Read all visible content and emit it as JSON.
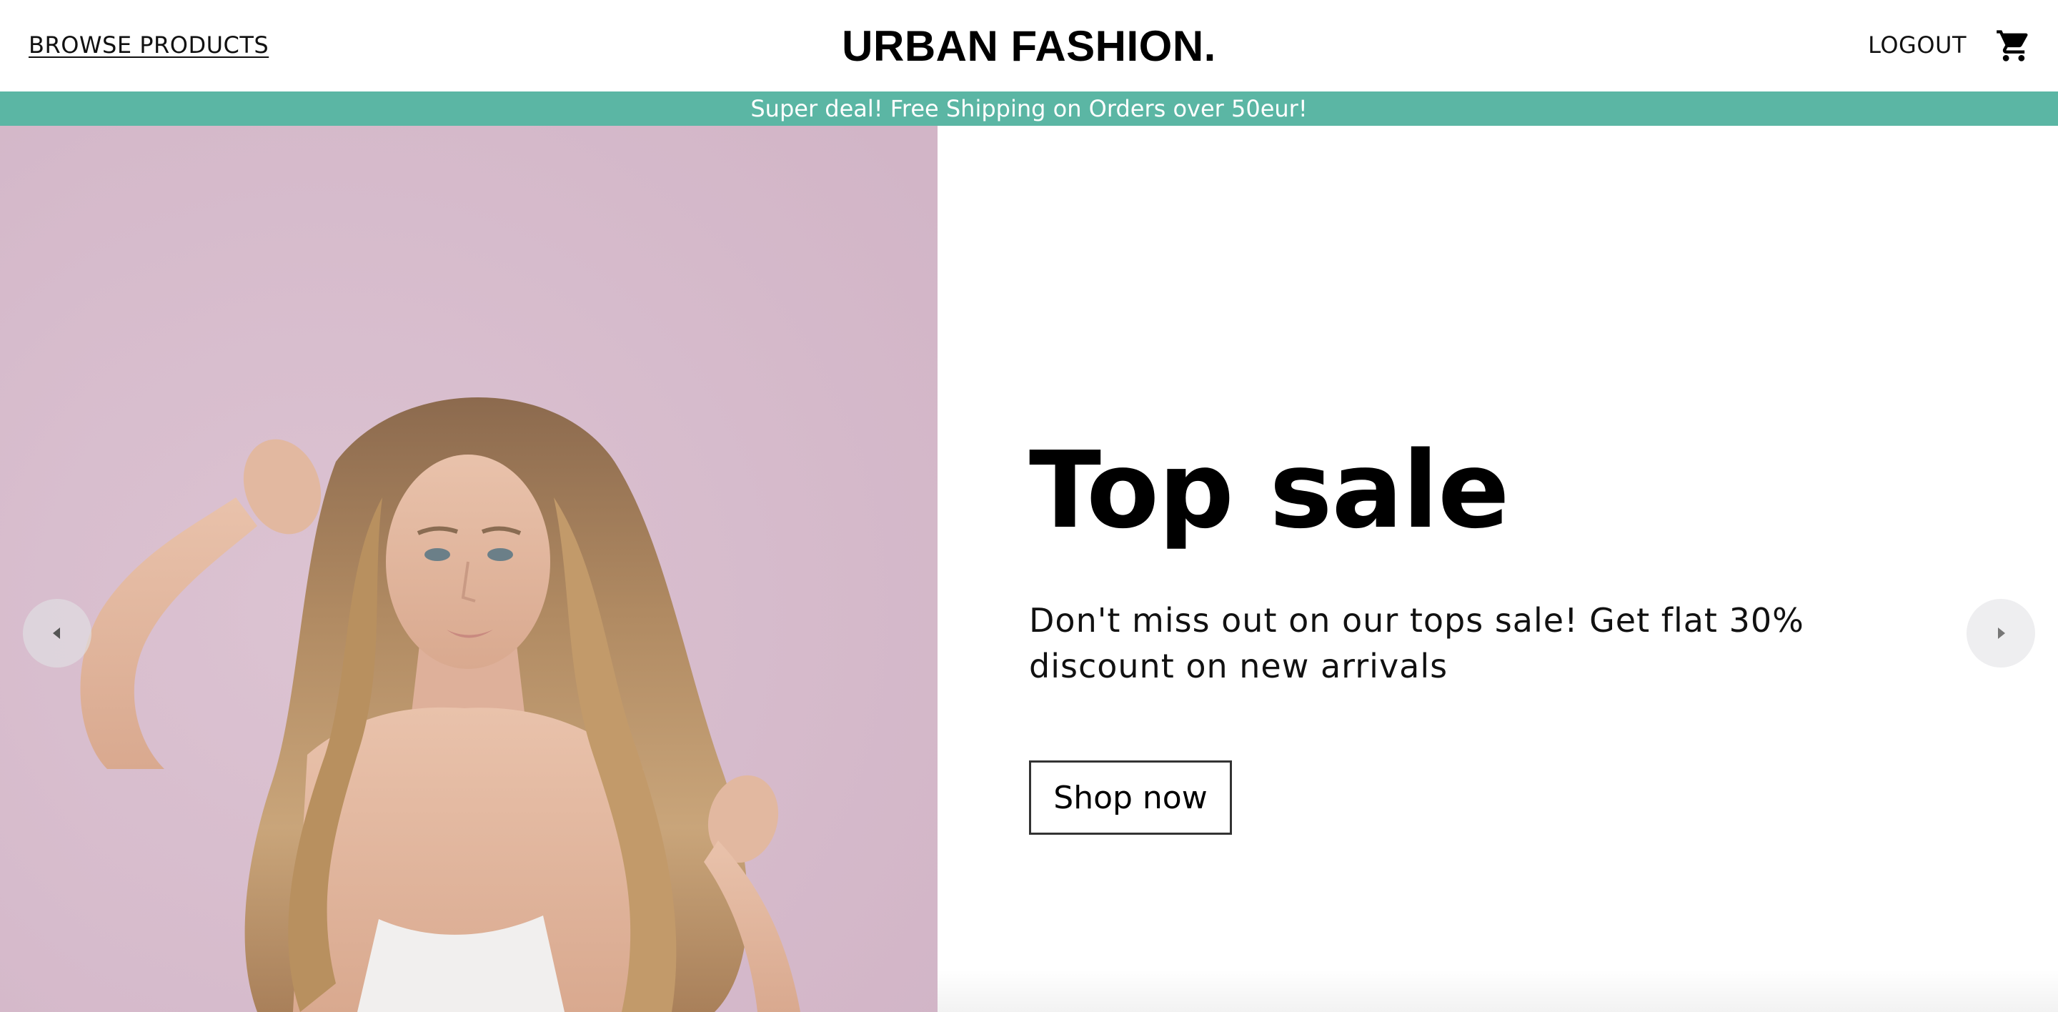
{
  "header": {
    "browse_label": "BROWSE PRODUCTS",
    "brand": "URBAN FASHION.",
    "logout_label": "LOGOUT",
    "cart_icon": "shopping-cart-icon"
  },
  "promo": {
    "text": "Super deal! Free Shipping on Orders over 50eur!",
    "background": "#5bb6a4"
  },
  "hero": {
    "title": "Top sale",
    "description": "Don't miss out on our tops sale! Get flat 30% discount on new arrivals",
    "cta_label": "Shop now",
    "prev_icon": "chevron-left-icon",
    "next_icon": "chevron-right-icon",
    "image_background": "#d6bccc"
  }
}
